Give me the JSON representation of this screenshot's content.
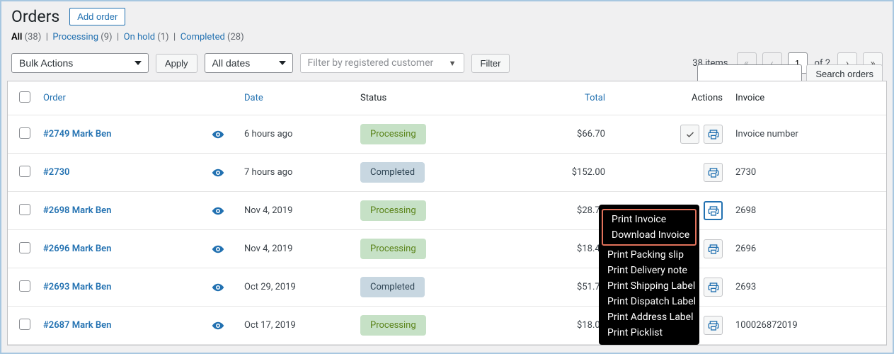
{
  "header": {
    "title": "Orders",
    "add_button": "Add order"
  },
  "filters": {
    "all_label": "All",
    "all_count": "(38)",
    "processing_label": "Processing",
    "processing_count": "(9)",
    "onhold_label": "On hold",
    "onhold_count": "(1)",
    "completed_label": "Completed",
    "completed_count": "(28)"
  },
  "search": {
    "button": "Search orders"
  },
  "bulk": {
    "bulk_actions": "Bulk Actions",
    "apply": "Apply",
    "all_dates": "All dates",
    "filter_customer_placeholder": "Filter by registered customer",
    "filter": "Filter"
  },
  "pagination": {
    "items": "38 items",
    "current": "1",
    "of": "of 2"
  },
  "columns": {
    "order": "Order",
    "date": "Date",
    "status": "Status",
    "total": "Total",
    "actions": "Actions",
    "invoice": "Invoice"
  },
  "rows": [
    {
      "order": "#2749 Mark Ben",
      "date": "6 hours ago",
      "status": "Processing",
      "status_class": "processing",
      "total": "$66.70",
      "has_complete": true,
      "invoice": "Invoice number"
    },
    {
      "order": "#2730",
      "date": "7 hours ago",
      "status": "Completed",
      "status_class": "completed",
      "total": "$152.00",
      "has_complete": false,
      "invoice": "2730"
    },
    {
      "order": "#2698 Mark Ben",
      "date": "Nov 4, 2019",
      "status": "Processing",
      "status_class": "processing",
      "total": "$28.75",
      "has_complete": false,
      "print_active": true,
      "invoice": "2698"
    },
    {
      "order": "#2696 Mark Ben",
      "date": "Nov 4, 2019",
      "status": "Processing",
      "status_class": "processing",
      "total": "$18.40",
      "has_complete": false,
      "invoice": "2696"
    },
    {
      "order": "#2693 Mark Ben",
      "date": "Oct 29, 2019",
      "status": "Completed",
      "status_class": "completed",
      "total": "$51.75",
      "has_complete": false,
      "invoice": "2693"
    },
    {
      "order": "#2687 Mark Ben",
      "date": "Oct 17, 2019",
      "status": "Processing",
      "status_class": "processing",
      "total": "$18.00",
      "has_complete": false,
      "invoice": "100026872019"
    }
  ],
  "dropdown": {
    "items": [
      "Print Invoice",
      "Download Invoice",
      "Print Packing slip",
      "Print Delivery note",
      "Print Shipping Label",
      "Print Dispatch Label",
      "Print Address Label",
      "Print Picklist"
    ]
  }
}
